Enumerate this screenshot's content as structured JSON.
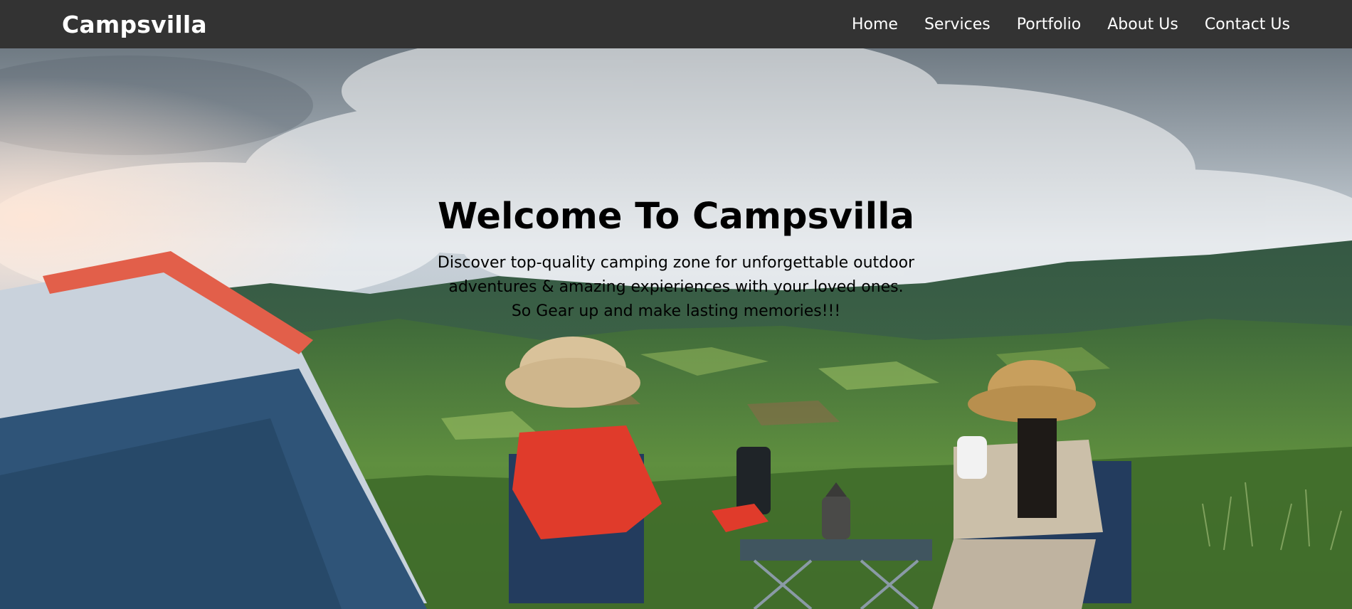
{
  "navbar": {
    "brand": "Campsvilla",
    "links": [
      {
        "label": "Home"
      },
      {
        "label": "Services"
      },
      {
        "label": "Portfolio"
      },
      {
        "label": "About Us"
      },
      {
        "label": "Contact Us"
      }
    ]
  },
  "hero": {
    "title": "Welcome To Campsvilla",
    "lines": [
      "Discover top-quality camping zone for unforgettable outdoor",
      "adventures & amazing expieriences with your loved ones.",
      "So Gear up and make lasting memories!!!"
    ]
  },
  "colors": {
    "navbar_bg": "#333333",
    "nav_text": "#ffffff",
    "hero_text": "#000000"
  }
}
